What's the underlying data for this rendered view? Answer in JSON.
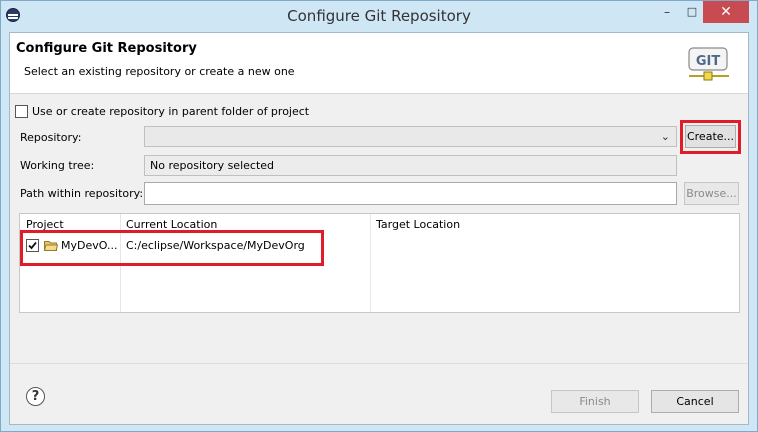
{
  "window": {
    "title": "Configure Git Repository",
    "controls": {
      "minimize": "–",
      "maximize": "□",
      "close": "✕"
    }
  },
  "header": {
    "title": "Configure Git Repository",
    "subtitle": "Select an existing repository or create a new one",
    "logo_text": "GIT"
  },
  "form": {
    "parent_folder_checkbox": {
      "label": "Use or create repository in parent folder of project",
      "checked": false
    },
    "repository": {
      "label": "Repository:",
      "value": ""
    },
    "create_button": "Create...",
    "working_tree": {
      "label": "Working tree:",
      "value": "No repository selected"
    },
    "path_within": {
      "label": "Path within repository:",
      "value": ""
    },
    "browse_button": "Browse..."
  },
  "table": {
    "columns": [
      "Project",
      "Current Location",
      "Target Location"
    ],
    "rows": [
      {
        "checked": true,
        "project": "MyDevO...",
        "current_location": "C:/eclipse/Workspace/MyDevOrg",
        "target_location": ""
      }
    ]
  },
  "footer": {
    "help": "?",
    "finish_button": "Finish",
    "cancel_button": "Cancel"
  },
  "colors": {
    "highlight": "#e01b2a",
    "title_bar": "#cfe6f5",
    "close_button": "#c74b50"
  }
}
